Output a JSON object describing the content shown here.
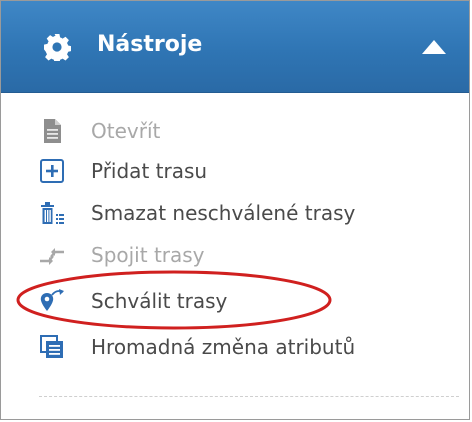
{
  "header": {
    "title": "Nástroje",
    "gear_icon": "gear-icon",
    "collapse_icon": "triangle-up-icon"
  },
  "menu": {
    "items": [
      {
        "label": "Otevřít",
        "icon": "document-icon",
        "enabled": false
      },
      {
        "label": "Přidat trasu",
        "icon": "plus-box-icon",
        "enabled": true
      },
      {
        "label": "Smazat neschválené trasy",
        "icon": "trash-list-icon",
        "enabled": true
      },
      {
        "label": "Spojit trasy",
        "icon": "merge-arrows-icon",
        "enabled": false
      },
      {
        "label": "Schválit trasy",
        "icon": "pin-route-icon",
        "enabled": true
      },
      {
        "label": "Hromadná změna atributů",
        "icon": "stacked-pages-icon",
        "enabled": true
      }
    ]
  },
  "colors": {
    "header_blue": "#2f75b4",
    "text": "#4a4a4a",
    "disabled_text": "#a8a8a8",
    "icon_blue": "#2e6db4",
    "highlight_red": "#d0201f"
  }
}
